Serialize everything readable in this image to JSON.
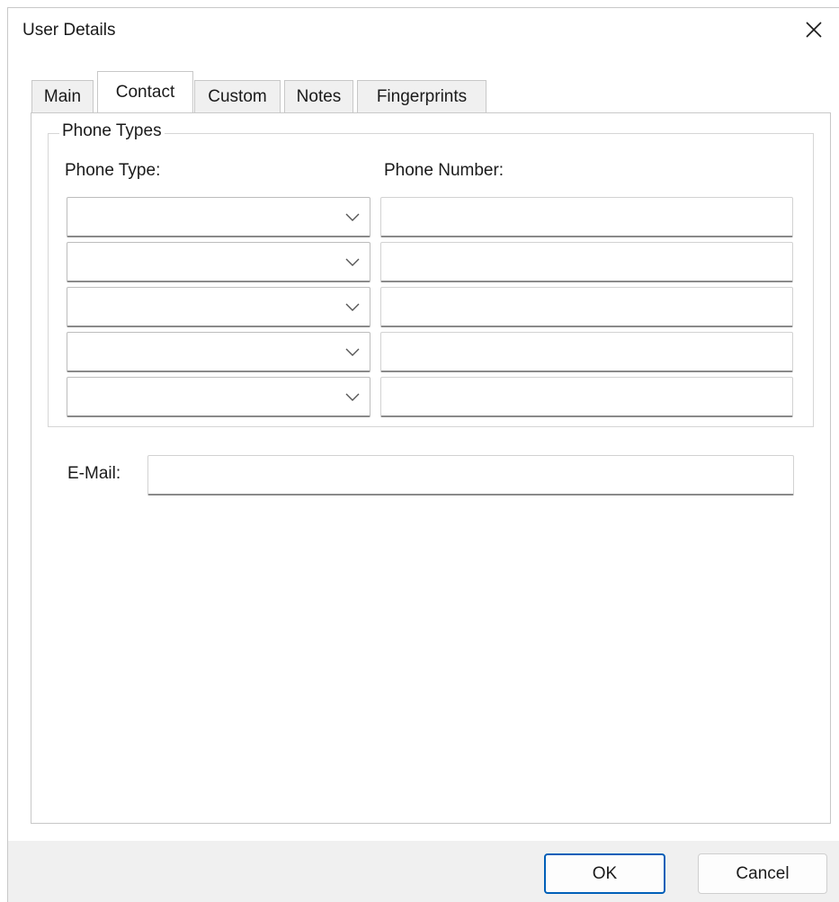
{
  "window": {
    "title": "User Details"
  },
  "tabs": [
    {
      "label": "Main",
      "active": false
    },
    {
      "label": "Contact",
      "active": true
    },
    {
      "label": "Custom",
      "active": false
    },
    {
      "label": "Notes",
      "active": false
    },
    {
      "label": "Fingerprints",
      "active": false
    }
  ],
  "phone_types": {
    "group_title": "Phone Types",
    "type_column_label": "Phone Type:",
    "number_column_label": "Phone Number:",
    "rows": [
      {
        "type": "",
        "number": ""
      },
      {
        "type": "",
        "number": ""
      },
      {
        "type": "",
        "number": ""
      },
      {
        "type": "",
        "number": ""
      },
      {
        "type": "",
        "number": ""
      }
    ]
  },
  "email": {
    "label": "E-Mail:",
    "value": ""
  },
  "buttons": {
    "ok_label": "OK",
    "cancel_label": "Cancel"
  },
  "colors": {
    "accent": "#005fb8",
    "window_bg": "#f0f0f0",
    "border": "#c8c8c8"
  },
  "icons": {
    "close": "close-icon",
    "dropdown": "chevron-down-icon"
  }
}
